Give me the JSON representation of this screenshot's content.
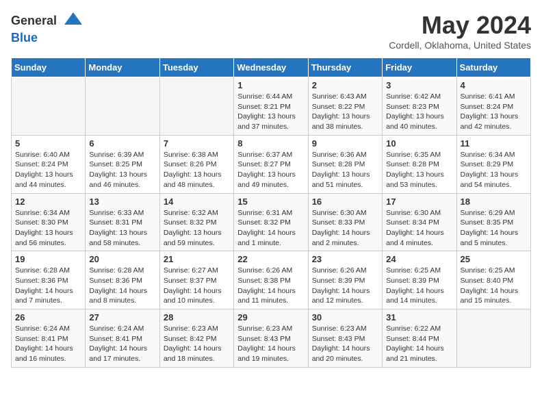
{
  "header": {
    "logo_line1": "General",
    "logo_line2": "Blue",
    "month": "May 2024",
    "location": "Cordell, Oklahoma, United States"
  },
  "weekdays": [
    "Sunday",
    "Monday",
    "Tuesday",
    "Wednesday",
    "Thursday",
    "Friday",
    "Saturday"
  ],
  "weeks": [
    [
      {
        "day": "",
        "info": ""
      },
      {
        "day": "",
        "info": ""
      },
      {
        "day": "",
        "info": ""
      },
      {
        "day": "1",
        "info": "Sunrise: 6:44 AM\nSunset: 8:21 PM\nDaylight: 13 hours and 37 minutes."
      },
      {
        "day": "2",
        "info": "Sunrise: 6:43 AM\nSunset: 8:22 PM\nDaylight: 13 hours and 38 minutes."
      },
      {
        "day": "3",
        "info": "Sunrise: 6:42 AM\nSunset: 8:23 PM\nDaylight: 13 hours and 40 minutes."
      },
      {
        "day": "4",
        "info": "Sunrise: 6:41 AM\nSunset: 8:24 PM\nDaylight: 13 hours and 42 minutes."
      }
    ],
    [
      {
        "day": "5",
        "info": "Sunrise: 6:40 AM\nSunset: 8:24 PM\nDaylight: 13 hours and 44 minutes."
      },
      {
        "day": "6",
        "info": "Sunrise: 6:39 AM\nSunset: 8:25 PM\nDaylight: 13 hours and 46 minutes."
      },
      {
        "day": "7",
        "info": "Sunrise: 6:38 AM\nSunset: 8:26 PM\nDaylight: 13 hours and 48 minutes."
      },
      {
        "day": "8",
        "info": "Sunrise: 6:37 AM\nSunset: 8:27 PM\nDaylight: 13 hours and 49 minutes."
      },
      {
        "day": "9",
        "info": "Sunrise: 6:36 AM\nSunset: 8:28 PM\nDaylight: 13 hours and 51 minutes."
      },
      {
        "day": "10",
        "info": "Sunrise: 6:35 AM\nSunset: 8:28 PM\nDaylight: 13 hours and 53 minutes."
      },
      {
        "day": "11",
        "info": "Sunrise: 6:34 AM\nSunset: 8:29 PM\nDaylight: 13 hours and 54 minutes."
      }
    ],
    [
      {
        "day": "12",
        "info": "Sunrise: 6:34 AM\nSunset: 8:30 PM\nDaylight: 13 hours and 56 minutes."
      },
      {
        "day": "13",
        "info": "Sunrise: 6:33 AM\nSunset: 8:31 PM\nDaylight: 13 hours and 58 minutes."
      },
      {
        "day": "14",
        "info": "Sunrise: 6:32 AM\nSunset: 8:32 PM\nDaylight: 13 hours and 59 minutes."
      },
      {
        "day": "15",
        "info": "Sunrise: 6:31 AM\nSunset: 8:32 PM\nDaylight: 14 hours and 1 minute."
      },
      {
        "day": "16",
        "info": "Sunrise: 6:30 AM\nSunset: 8:33 PM\nDaylight: 14 hours and 2 minutes."
      },
      {
        "day": "17",
        "info": "Sunrise: 6:30 AM\nSunset: 8:34 PM\nDaylight: 14 hours and 4 minutes."
      },
      {
        "day": "18",
        "info": "Sunrise: 6:29 AM\nSunset: 8:35 PM\nDaylight: 14 hours and 5 minutes."
      }
    ],
    [
      {
        "day": "19",
        "info": "Sunrise: 6:28 AM\nSunset: 8:36 PM\nDaylight: 14 hours and 7 minutes."
      },
      {
        "day": "20",
        "info": "Sunrise: 6:28 AM\nSunset: 8:36 PM\nDaylight: 14 hours and 8 minutes."
      },
      {
        "day": "21",
        "info": "Sunrise: 6:27 AM\nSunset: 8:37 PM\nDaylight: 14 hours and 10 minutes."
      },
      {
        "day": "22",
        "info": "Sunrise: 6:26 AM\nSunset: 8:38 PM\nDaylight: 14 hours and 11 minutes."
      },
      {
        "day": "23",
        "info": "Sunrise: 6:26 AM\nSunset: 8:39 PM\nDaylight: 14 hours and 12 minutes."
      },
      {
        "day": "24",
        "info": "Sunrise: 6:25 AM\nSunset: 8:39 PM\nDaylight: 14 hours and 14 minutes."
      },
      {
        "day": "25",
        "info": "Sunrise: 6:25 AM\nSunset: 8:40 PM\nDaylight: 14 hours and 15 minutes."
      }
    ],
    [
      {
        "day": "26",
        "info": "Sunrise: 6:24 AM\nSunset: 8:41 PM\nDaylight: 14 hours and 16 minutes."
      },
      {
        "day": "27",
        "info": "Sunrise: 6:24 AM\nSunset: 8:41 PM\nDaylight: 14 hours and 17 minutes."
      },
      {
        "day": "28",
        "info": "Sunrise: 6:23 AM\nSunset: 8:42 PM\nDaylight: 14 hours and 18 minutes."
      },
      {
        "day": "29",
        "info": "Sunrise: 6:23 AM\nSunset: 8:43 PM\nDaylight: 14 hours and 19 minutes."
      },
      {
        "day": "30",
        "info": "Sunrise: 6:23 AM\nSunset: 8:43 PM\nDaylight: 14 hours and 20 minutes."
      },
      {
        "day": "31",
        "info": "Sunrise: 6:22 AM\nSunset: 8:44 PM\nDaylight: 14 hours and 21 minutes."
      },
      {
        "day": "",
        "info": ""
      }
    ]
  ]
}
